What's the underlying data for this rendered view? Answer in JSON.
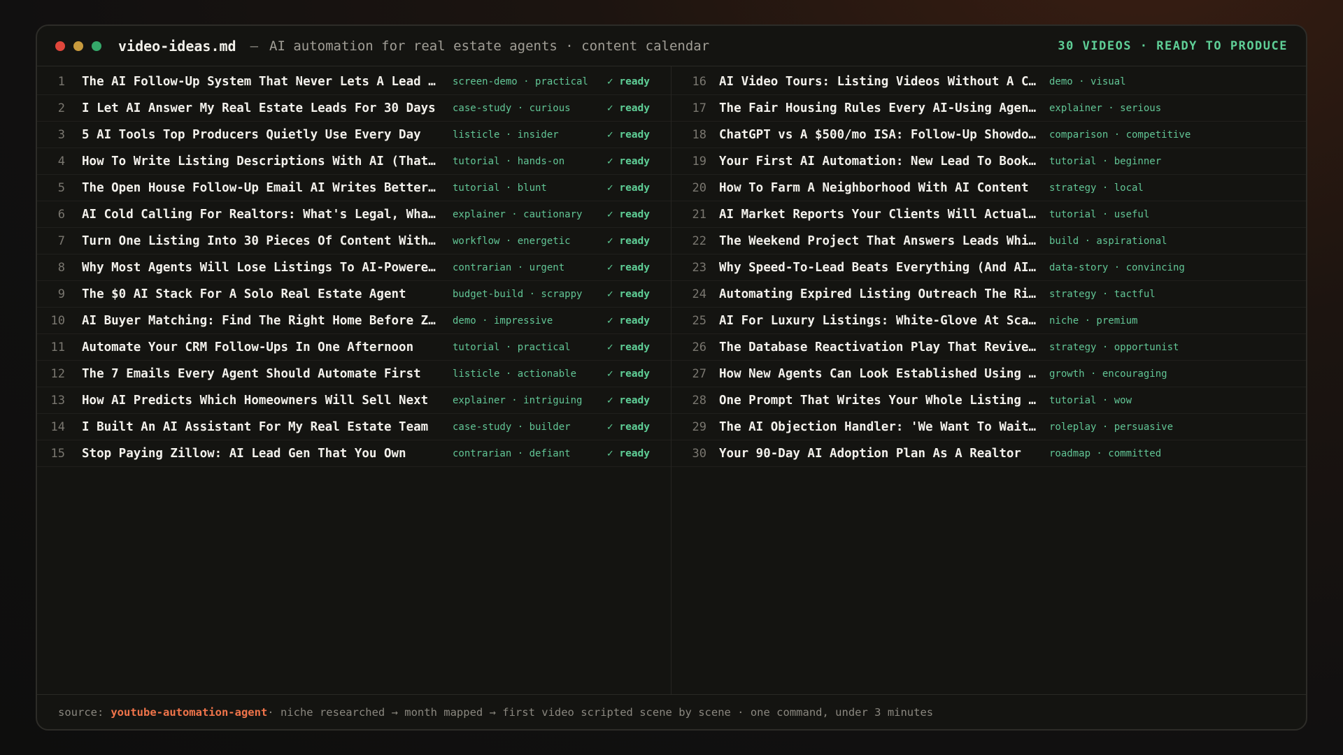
{
  "window": {
    "filename": "video-ideas.md",
    "separator": "—",
    "description": "AI automation for real estate agents · content calendar",
    "status": "30 VIDEOS · READY TO PRODUCE",
    "dot_colors": [
      "#e0463b",
      "#c89a3d",
      "#35a96a"
    ]
  },
  "videos_left": [
    {
      "num": "1",
      "title": "The AI Follow-Up System That Never Lets A Lead Go C…",
      "tags": "screen-demo · practical",
      "status": "✓ ready"
    },
    {
      "num": "2",
      "title": "I Let AI Answer My Real Estate Leads For 30 Days",
      "tags": "case-study · curious",
      "status": "✓ ready"
    },
    {
      "num": "3",
      "title": "5 AI Tools Top Producers Quietly Use Every Day",
      "tags": "listicle · insider",
      "status": "✓ ready"
    },
    {
      "num": "4",
      "title": "How To Write Listing Descriptions With AI (That Don…",
      "tags": "tutorial · hands-on",
      "status": "✓ ready"
    },
    {
      "num": "5",
      "title": "The Open House Follow-Up Email AI Writes Better Tha…",
      "tags": "tutorial · blunt",
      "status": "✓ ready"
    },
    {
      "num": "6",
      "title": "AI Cold Calling For Realtors: What's Legal, What's …",
      "tags": "explainer · cautionary",
      "status": "✓ ready"
    },
    {
      "num": "7",
      "title": "Turn One Listing Into 30 Pieces Of Content With AI",
      "tags": "workflow · energetic",
      "status": "✓ ready"
    },
    {
      "num": "8",
      "title": "Why Most Agents Will Lose Listings To AI-Powered Ag…",
      "tags": "contrarian · urgent",
      "status": "✓ ready"
    },
    {
      "num": "9",
      "title": "The $0 AI Stack For A Solo Real Estate Agent",
      "tags": "budget-build · scrappy",
      "status": "✓ ready"
    },
    {
      "num": "10",
      "title": "AI Buyer Matching: Find The Right Home Before Zillo…",
      "tags": "demo · impressive",
      "status": "✓ ready"
    },
    {
      "num": "11",
      "title": "Automate Your CRM Follow-Ups In One Afternoon",
      "tags": "tutorial · practical",
      "status": "✓ ready"
    },
    {
      "num": "12",
      "title": "The 7 Emails Every Agent Should Automate First",
      "tags": "listicle · actionable",
      "status": "✓ ready"
    },
    {
      "num": "13",
      "title": "How AI Predicts Which Homeowners Will Sell Next",
      "tags": "explainer · intriguing",
      "status": "✓ ready"
    },
    {
      "num": "14",
      "title": "I Built An AI Assistant For My Real Estate Team",
      "tags": "case-study · builder",
      "status": "✓ ready"
    },
    {
      "num": "15",
      "title": "Stop Paying Zillow: AI Lead Gen That You Own",
      "tags": "contrarian · defiant",
      "status": "✓ ready"
    }
  ],
  "videos_right": [
    {
      "num": "16",
      "title": "AI Video Tours: Listing Videos Without A Came…",
      "tags": "demo · visual"
    },
    {
      "num": "17",
      "title": "The Fair Housing Rules Every AI-Using Agent M…",
      "tags": "explainer · serious"
    },
    {
      "num": "18",
      "title": "ChatGPT vs A $500/mo ISA: Follow-Up Showdown",
      "tags": "comparison · competitive"
    },
    {
      "num": "19",
      "title": "Your First AI Automation: New Lead To Booked …",
      "tags": "tutorial · beginner"
    },
    {
      "num": "20",
      "title": "How To Farm A Neighborhood With AI Content",
      "tags": "strategy · local"
    },
    {
      "num": "21",
      "title": "AI Market Reports Your Clients Will Actually …",
      "tags": "tutorial · useful"
    },
    {
      "num": "22",
      "title": "The Weekend Project That Answers Leads While …",
      "tags": "build · aspirational"
    },
    {
      "num": "23",
      "title": "Why Speed-To-Lead Beats Everything (And AI Wi…",
      "tags": "data-story · convincing"
    },
    {
      "num": "24",
      "title": "Automating Expired Listing Outreach The Right…",
      "tags": "strategy · tactful"
    },
    {
      "num": "25",
      "title": "AI For Luxury Listings: White-Glove At Scale",
      "tags": "niche · premium"
    },
    {
      "num": "26",
      "title": "The Database Reactivation Play That Revives D…",
      "tags": "strategy · opportunist"
    },
    {
      "num": "27",
      "title": "How New Agents Can Look Established Using AI",
      "tags": "growth · encouraging"
    },
    {
      "num": "28",
      "title": "One Prompt That Writes Your Whole Listing Lau…",
      "tags": "tutorial · wow"
    },
    {
      "num": "29",
      "title": "The AI Objection Handler: 'We Want To Wait Fo…",
      "tags": "roleplay · persuasive"
    },
    {
      "num": "30",
      "title": "Your 90-Day AI Adoption Plan As A Realtor",
      "tags": "roadmap · committed"
    }
  ],
  "footer": {
    "label": "source:",
    "source_name": "youtube-automation-agent",
    "description": " · niche researched → month mapped → first video scripted scene by scene · one command, under 3 minutes"
  },
  "colors": {
    "accent_green": "#5fcf97",
    "accent_orange": "#f0744a",
    "text_primary": "#f3f1ec",
    "text_muted": "#8a877f"
  }
}
